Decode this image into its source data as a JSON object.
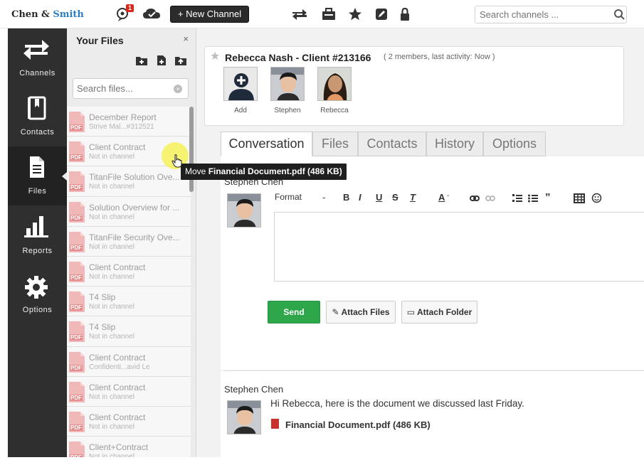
{
  "brand": {
    "chen": "Chen",
    "amp": " & ",
    "smith": "Smith"
  },
  "header": {
    "notification_count": "1",
    "new_channel_label": "+ New Channel",
    "search_placeholder": "Search channels ..."
  },
  "nav": {
    "items": [
      {
        "label": "Channels",
        "icon": "arrows-icon"
      },
      {
        "label": "Contacts",
        "icon": "contacts-book-icon"
      },
      {
        "label": "Files",
        "icon": "file-icon"
      },
      {
        "label": "Reports",
        "icon": "bar-chart-icon"
      },
      {
        "label": "Options",
        "icon": "gear-icon"
      }
    ],
    "active": "Files"
  },
  "files_panel": {
    "title": "Your Files",
    "close": "×",
    "search_placeholder": "Search files...",
    "clear": "×",
    "pdf_badge": "PDF",
    "files": [
      {
        "name": "December Report",
        "sub": "Strive Mal...#312521"
      },
      {
        "name": "Client Contract",
        "sub": "Not in channel"
      },
      {
        "name": "TitanFile Solution Ove...",
        "sub": "Not in channel"
      },
      {
        "name": "Solution Overview for ...",
        "sub": "Not in channel"
      },
      {
        "name": "TitanFile Security Ove...",
        "sub": "Not in channel"
      },
      {
        "name": "Client Contract",
        "sub": "Not in channel"
      },
      {
        "name": "T4 Slip",
        "sub": "Not in channel"
      },
      {
        "name": "T4 Slip",
        "sub": "Not in channel"
      },
      {
        "name": "Client Contract",
        "sub": "Confidenti...avid Le"
      },
      {
        "name": "Client Contract",
        "sub": "Not in channel"
      },
      {
        "name": "Client Contract",
        "sub": "Not in channel"
      },
      {
        "name": "Client+Contract",
        "sub": "Not in channel"
      }
    ]
  },
  "channel": {
    "title": "Rebecca Nash - Client #213166",
    "meta": "( 2 members, last activity: Now )",
    "members": [
      {
        "label": "Add"
      },
      {
        "label": "Stephen"
      },
      {
        "label": "Rebecca"
      }
    ]
  },
  "tabs": [
    "Conversation",
    "Files",
    "Contacts",
    "History",
    "Options"
  ],
  "active_tab": "Conversation",
  "composer": {
    "author": "Stephen Chen",
    "format_label": "Format",
    "format_caret": "-",
    "send": "Send",
    "attach_files": "Attach Files",
    "attach_folder": "Attach Folder"
  },
  "message": {
    "author": "Stephen Chen",
    "text": "Hi Rebecca, here is the document we discussed last Friday.",
    "file": "Financial Document.pdf (486 KB)"
  },
  "tooltip": {
    "prefix": "Move ",
    "file": "Financial Document.pdf (486 KB)"
  },
  "colors": {
    "accent_blue": "#2d7fc1",
    "nav_bg": "#2f2f2f",
    "send_green": "#2ea64a",
    "badge_red": "#d9261c",
    "pdf_red": "#c9302c"
  }
}
